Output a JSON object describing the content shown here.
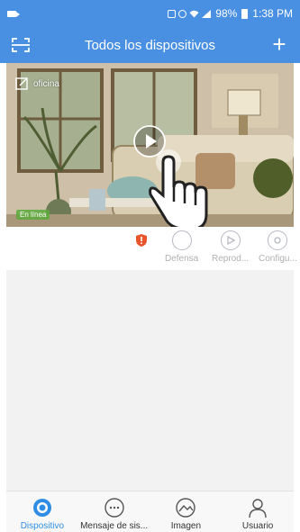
{
  "status_bar": {
    "battery": "98%",
    "time": "1:38 PM"
  },
  "header": {
    "title": "Todos los dispositivos",
    "add_label": "+"
  },
  "device": {
    "name": "oficina",
    "status": "En línea"
  },
  "actions": [
    {
      "label": "Defensa",
      "icon": "defense-icon"
    },
    {
      "label": "Reprod...",
      "icon": "playback-icon"
    },
    {
      "label": "Configu...",
      "icon": "settings-icon"
    }
  ],
  "tabs": [
    {
      "label": "Dispositivo",
      "icon": "camera-icon",
      "active": true
    },
    {
      "label": "Mensaje de sis...",
      "icon": "message-icon",
      "active": false
    },
    {
      "label": "Imagen",
      "icon": "image-icon",
      "active": false
    },
    {
      "label": "Usuario",
      "icon": "user-icon",
      "active": false
    }
  ],
  "colors": {
    "primary": "#4a90e2",
    "active_tab": "#2f8de4",
    "alert": "#e8542b"
  }
}
